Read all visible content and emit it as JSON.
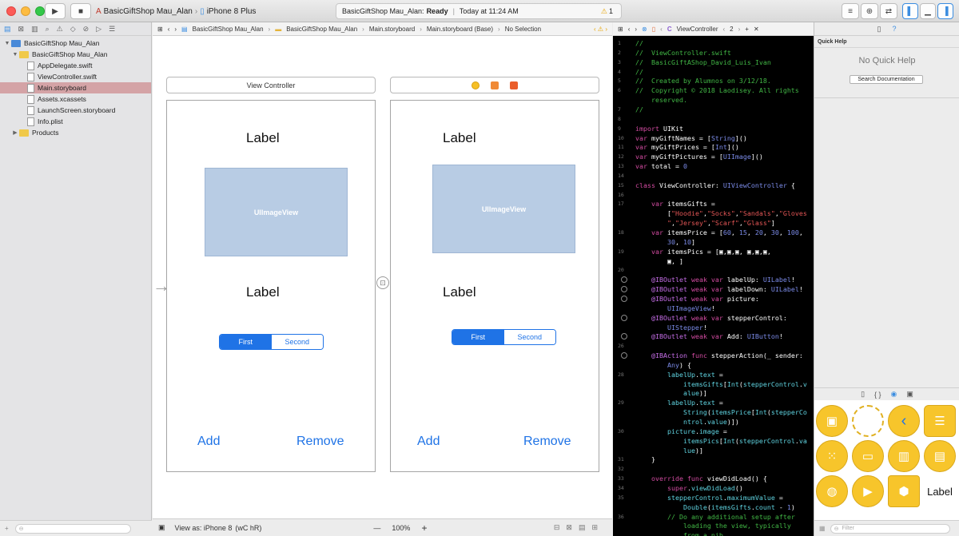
{
  "toolbar": {
    "scheme_name": "BasicGiftShop Mau_Alan",
    "device": "iPhone 8 Plus",
    "activity_project": "BasicGiftShop Mau_Alan:",
    "activity_status": "Ready",
    "activity_time": "Today at 11:24 AM",
    "warning_count": "1"
  },
  "navigator": {
    "items": [
      {
        "label": "BasicGiftShop Mau_Alan",
        "kind": "project",
        "indent": 0,
        "open": true
      },
      {
        "label": "BasicGiftShop Mau_Alan",
        "kind": "folder",
        "indent": 1,
        "open": true
      },
      {
        "label": "AppDelegate.swift",
        "kind": "file",
        "indent": 2
      },
      {
        "label": "ViewController.swift",
        "kind": "file",
        "indent": 2
      },
      {
        "label": "Main.storyboard",
        "kind": "file",
        "indent": 2,
        "selected": true
      },
      {
        "label": "Assets.xcassets",
        "kind": "file",
        "indent": 2
      },
      {
        "label": "LaunchScreen.storyboard",
        "kind": "file",
        "indent": 2
      },
      {
        "label": "Info.plist",
        "kind": "file",
        "indent": 2
      },
      {
        "label": "Products",
        "kind": "folder",
        "indent": 1,
        "open": false
      }
    ]
  },
  "storyboard_jump": {
    "crumbs": [
      "BasicGiftShop Mau_Alan",
      "BasicGiftShop Mau_Alan",
      "Main.storyboard",
      "Main.storyboard (Base)",
      "No Selection"
    ]
  },
  "scenes": {
    "left_title": "View Controller",
    "label_top": "Label",
    "label_bottom": "Label",
    "image_view": "UIImageView",
    "seg_first": "First",
    "seg_second": "Second",
    "add": "Add",
    "remove": "Remove"
  },
  "canvas_footer": {
    "view_as": "View as: iPhone 8",
    "size_class": "(wC hR)",
    "zoom": "100%",
    "minus": "—",
    "plus": "+"
  },
  "editor_jump": {
    "file": "ViewController",
    "counter": "2"
  },
  "code": [
    {
      "n": "1",
      "parts": [
        [
          "c-com",
          "//"
        ]
      ]
    },
    {
      "n": "2",
      "parts": [
        [
          "c-com",
          "//  ViewController.swift"
        ]
      ]
    },
    {
      "n": "3",
      "parts": [
        [
          "c-com",
          "//  BasicGiftAShop_David_Luis_Ivan"
        ]
      ]
    },
    {
      "n": "4",
      "parts": [
        [
          "c-com",
          "//"
        ]
      ]
    },
    {
      "n": "5",
      "parts": [
        [
          "c-com",
          "//  Created by Alumnos on 3/12/18."
        ]
      ]
    },
    {
      "n": "6",
      "parts": [
        [
          "c-com",
          "//  Copyright © 2018 Laodisey. All rights"
        ]
      ]
    },
    {
      "n": "",
      "parts": [
        [
          "c-com",
          "    reserved."
        ]
      ]
    },
    {
      "n": "7",
      "parts": [
        [
          "c-com",
          "//"
        ]
      ]
    },
    {
      "n": "8",
      "parts": []
    },
    {
      "n": "9",
      "parts": [
        [
          "c-kw",
          "import"
        ],
        [
          "",
          " UIKit"
        ]
      ]
    },
    {
      "n": "10",
      "parts": [
        [
          "c-kw",
          "var"
        ],
        [
          "",
          " myGiftNames = ["
        ],
        [
          "c-ty",
          "String"
        ],
        [
          "",
          "]()"
        ]
      ]
    },
    {
      "n": "11",
      "parts": [
        [
          "c-kw",
          "var"
        ],
        [
          "",
          " myGiftPrices = ["
        ],
        [
          "c-ty",
          "Int"
        ],
        [
          "",
          "]()"
        ]
      ]
    },
    {
      "n": "12",
      "parts": [
        [
          "c-kw",
          "var"
        ],
        [
          "",
          " myGiftPictures = ["
        ],
        [
          "c-ty",
          "UIImage"
        ],
        [
          "",
          "]()"
        ]
      ]
    },
    {
      "n": "13",
      "parts": [
        [
          "c-kw",
          "var"
        ],
        [
          "",
          " total = "
        ],
        [
          "c-num",
          "0"
        ]
      ]
    },
    {
      "n": "14",
      "parts": []
    },
    {
      "n": "15",
      "parts": [
        [
          "c-kw",
          "class"
        ],
        [
          "",
          " ViewController: "
        ],
        [
          "c-ty",
          "UIViewController"
        ],
        [
          "",
          " {"
        ]
      ]
    },
    {
      "n": "16",
      "parts": []
    },
    {
      "n": "17",
      "parts": [
        [
          "",
          "    "
        ],
        [
          "c-kw",
          "var"
        ],
        [
          "",
          " itemsGifts ="
        ]
      ]
    },
    {
      "n": "",
      "parts": [
        [
          "",
          "        ["
        ],
        [
          "c-str",
          "\"Hoodie\""
        ],
        [
          "",
          ","
        ],
        [
          "c-str",
          "\"Socks\""
        ],
        [
          "",
          ","
        ],
        [
          "c-str",
          "\"Sandals\""
        ],
        [
          "",
          ","
        ],
        [
          "c-str",
          "\"Gloves"
        ]
      ]
    },
    {
      "n": "",
      "parts": [
        [
          "c-str",
          "        \""
        ],
        [
          "",
          ","
        ],
        [
          "c-str",
          "\"Jersey\""
        ],
        [
          "",
          ","
        ],
        [
          "c-str",
          "\"Scarf\""
        ],
        [
          "",
          ","
        ],
        [
          "c-str",
          "\"Glass\""
        ],
        [
          "",
          "]"
        ]
      ]
    },
    {
      "n": "18",
      "parts": [
        [
          "",
          "    "
        ],
        [
          "c-kw",
          "var"
        ],
        [
          "",
          " itemsPrice = ["
        ],
        [
          "c-num",
          "60"
        ],
        [
          "",
          ", "
        ],
        [
          "c-num",
          "15"
        ],
        [
          "",
          ", "
        ],
        [
          "c-num",
          "20"
        ],
        [
          "",
          ", "
        ],
        [
          "c-num",
          "30"
        ],
        [
          "",
          ", "
        ],
        [
          "c-num",
          "100"
        ],
        [
          "",
          ","
        ]
      ]
    },
    {
      "n": "",
      "parts": [
        [
          "",
          "        "
        ],
        [
          "c-num",
          "30"
        ],
        [
          "",
          ", "
        ],
        [
          "c-num",
          "10"
        ],
        [
          "",
          "]"
        ]
      ]
    },
    {
      "n": "19",
      "parts": [
        [
          "",
          "    "
        ],
        [
          "c-kw",
          "var"
        ],
        [
          "",
          " itemsPics = [▣,▣,▣, ▣,▣,▣,"
        ]
      ]
    },
    {
      "n": "",
      "parts": [
        [
          "",
          "        ▣, ]"
        ]
      ]
    },
    {
      "n": "20",
      "parts": []
    },
    {
      "n": "o",
      "parts": [
        [
          "",
          "    "
        ],
        [
          "c-at",
          "@IBOutlet"
        ],
        [
          "",
          " "
        ],
        [
          "c-kw",
          "weak var"
        ],
        [
          "",
          " labelUp: "
        ],
        [
          "c-ty",
          "UILabel"
        ],
        [
          "",
          "!"
        ]
      ]
    },
    {
      "n": "o",
      "parts": [
        [
          "",
          "    "
        ],
        [
          "c-at",
          "@IBOutlet"
        ],
        [
          "",
          " "
        ],
        [
          "c-kw",
          "weak var"
        ],
        [
          "",
          " labelDown: "
        ],
        [
          "c-ty",
          "UILabel"
        ],
        [
          "",
          "!"
        ]
      ]
    },
    {
      "n": "o",
      "parts": [
        [
          "",
          "    "
        ],
        [
          "c-at",
          "@IBOutlet"
        ],
        [
          "",
          " "
        ],
        [
          "c-kw",
          "weak var"
        ],
        [
          "",
          " picture:"
        ]
      ]
    },
    {
      "n": "",
      "parts": [
        [
          "",
          "        "
        ],
        [
          "c-ty",
          "UIImageView"
        ],
        [
          "",
          "!"
        ]
      ]
    },
    {
      "n": "o",
      "parts": [
        [
          "",
          "    "
        ],
        [
          "c-at",
          "@IBOutlet"
        ],
        [
          "",
          " "
        ],
        [
          "c-kw",
          "weak var"
        ],
        [
          "",
          " stepperControl:"
        ]
      ]
    },
    {
      "n": "",
      "parts": [
        [
          "",
          "        "
        ],
        [
          "c-ty",
          "UIStepper"
        ],
        [
          "",
          "!"
        ]
      ]
    },
    {
      "n": "o",
      "parts": [
        [
          "",
          "    "
        ],
        [
          "c-at",
          "@IBOutlet"
        ],
        [
          "",
          " "
        ],
        [
          "c-kw",
          "weak var"
        ],
        [
          "",
          " Add: "
        ],
        [
          "c-ty",
          "UIButton"
        ],
        [
          "",
          "!"
        ]
      ]
    },
    {
      "n": "26",
      "parts": []
    },
    {
      "n": "o",
      "parts": [
        [
          "",
          "    "
        ],
        [
          "c-at",
          "@IBAction"
        ],
        [
          "",
          " "
        ],
        [
          "c-kw",
          "func"
        ],
        [
          "",
          " stepperAction(_ sender:"
        ]
      ]
    },
    {
      "n": "",
      "parts": [
        [
          "",
          "        "
        ],
        [
          "c-ty",
          "Any"
        ],
        [
          "",
          ") {"
        ]
      ]
    },
    {
      "n": "28",
      "parts": [
        [
          "",
          "        "
        ],
        [
          "c-fn",
          "labelUp"
        ],
        [
          "",
          "."
        ],
        [
          "c-fn",
          "text"
        ],
        [
          "",
          " ="
        ]
      ]
    },
    {
      "n": "",
      "parts": [
        [
          "",
          "            "
        ],
        [
          "c-fn",
          "itemsGifts"
        ],
        [
          "",
          "["
        ],
        [
          "c-fn",
          "Int"
        ],
        [
          "",
          "("
        ],
        [
          "c-fn",
          "stepperControl"
        ],
        [
          "",
          "."
        ],
        [
          "c-fn",
          "v"
        ]
      ]
    },
    {
      "n": "",
      "parts": [
        [
          "",
          "            "
        ],
        [
          "c-fn",
          "alue"
        ],
        [
          "",
          ")]"
        ]
      ]
    },
    {
      "n": "29",
      "parts": [
        [
          "",
          "        "
        ],
        [
          "c-fn",
          "labelUp"
        ],
        [
          "",
          "."
        ],
        [
          "c-fn",
          "text"
        ],
        [
          "",
          " ="
        ]
      ]
    },
    {
      "n": "",
      "parts": [
        [
          "",
          "            "
        ],
        [
          "c-fn",
          "String"
        ],
        [
          "",
          "("
        ],
        [
          "c-fn",
          "itemsPrice"
        ],
        [
          "",
          "["
        ],
        [
          "c-fn",
          "Int"
        ],
        [
          "",
          "("
        ],
        [
          "c-fn",
          "stepperCo"
        ]
      ]
    },
    {
      "n": "",
      "parts": [
        [
          "",
          "            "
        ],
        [
          "c-fn",
          "ntrol"
        ],
        [
          "",
          "."
        ],
        [
          "c-fn",
          "value"
        ],
        [
          "",
          ")])"
        ]
      ]
    },
    {
      "n": "30",
      "parts": [
        [
          "",
          "        "
        ],
        [
          "c-fn",
          "picture"
        ],
        [
          "",
          "."
        ],
        [
          "c-fn",
          "image"
        ],
        [
          "",
          " ="
        ]
      ]
    },
    {
      "n": "",
      "parts": [
        [
          "",
          "            "
        ],
        [
          "c-fn",
          "itemsPics"
        ],
        [
          "",
          "["
        ],
        [
          "c-fn",
          "Int"
        ],
        [
          "",
          "("
        ],
        [
          "c-fn",
          "stepperControl"
        ],
        [
          "",
          "."
        ],
        [
          "c-fn",
          "va"
        ]
      ]
    },
    {
      "n": "",
      "parts": [
        [
          "",
          "            "
        ],
        [
          "c-fn",
          "lue"
        ],
        [
          "",
          ")]"
        ]
      ]
    },
    {
      "n": "31",
      "parts": [
        [
          "",
          "    }"
        ]
      ]
    },
    {
      "n": "32",
      "parts": []
    },
    {
      "n": "33",
      "parts": [
        [
          "",
          "    "
        ],
        [
          "c-kw",
          "override func"
        ],
        [
          "",
          " viewDidLoad() {"
        ]
      ]
    },
    {
      "n": "34",
      "parts": [
        [
          "",
          "        "
        ],
        [
          "c-kw",
          "super"
        ],
        [
          "",
          "."
        ],
        [
          "c-fn",
          "viewDidLoad"
        ],
        [
          "",
          "()"
        ]
      ]
    },
    {
      "n": "35",
      "parts": [
        [
          "",
          "        "
        ],
        [
          "c-fn",
          "stepperControl"
        ],
        [
          "",
          "."
        ],
        [
          "c-fn",
          "maximumValue"
        ],
        [
          "",
          " ="
        ]
      ]
    },
    {
      "n": "",
      "parts": [
        [
          "",
          "            "
        ],
        [
          "c-fn",
          "Double"
        ],
        [
          "",
          "("
        ],
        [
          "c-fn",
          "itemsGifts"
        ],
        [
          "",
          "."
        ],
        [
          "c-fn",
          "count"
        ],
        [
          "",
          " - "
        ],
        [
          "c-num",
          "1"
        ],
        [
          "",
          ")"
        ]
      ]
    },
    {
      "n": "36",
      "parts": [
        [
          "",
          "        "
        ],
        [
          "c-com",
          "// Do any additional setup after"
        ]
      ]
    },
    {
      "n": "",
      "parts": [
        [
          "c-com",
          "            loading the view, typically"
        ]
      ]
    },
    {
      "n": "",
      "parts": [
        [
          "c-com",
          "            from a nib."
        ]
      ]
    }
  ],
  "inspector": {
    "section_title": "Quick Help",
    "no_help": "No Quick Help",
    "search_button": "Search Documentation",
    "library_label": "Label",
    "filter_placeholder": "Filter"
  }
}
